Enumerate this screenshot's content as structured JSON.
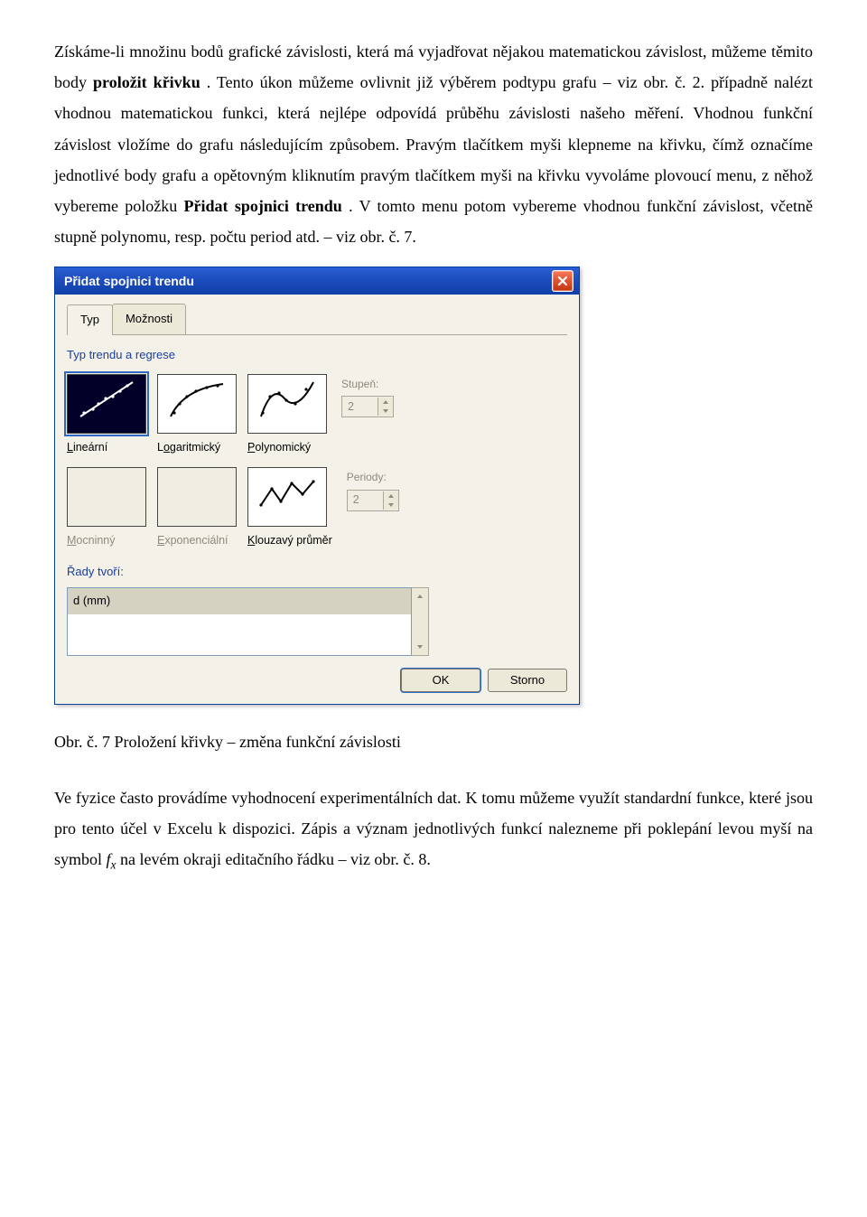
{
  "paragraph1": {
    "t1": "Získáme-li množinu bodů grafické závislosti, která má vyjadřovat nějakou matematickou závislost, můžeme těmito body ",
    "bold1": "proložit křivku",
    "t2": ". Tento úkon můžeme ovlivnit již výběrem podtypu grafu – viz obr. č. 2. případně nalézt vhodnou matematickou funkci, která nejlépe odpovídá průběhu závislosti našeho měření. Vhodnou funkční závislost vložíme do grafu následujícím způsobem. Pravým tlačítkem myši klepneme na křivku, čímž označíme jednotlivé body grafu a opětovným kliknutím pravým tlačítkem myši na křivku vyvoláme plovoucí menu, z něhož vybereme položku ",
    "bold2": "Přidat spojnici trendu",
    "t3": ". V tomto menu potom vybereme vhodnou funkční závislost, včetně stupně polynomu, resp. počtu period atd. – viz obr. č. 7."
  },
  "dialog": {
    "title": "Přidat spojnici trendu",
    "tabs": {
      "type": "Typ",
      "options": "Možnosti"
    },
    "group_label": "Typ trendu a regrese",
    "trend": {
      "linear": "Lineární",
      "log": "Logaritmický",
      "poly": "Polynomický",
      "power": "Mocninný",
      "expo": "Exponenciální",
      "movavg": "Klouzavý průměr"
    },
    "degree_label": "Stupeň:",
    "degree_value": "2",
    "periods_label": "Periody:",
    "periods_value": "2",
    "series_label": "Řady tvoří:",
    "series_item": "d (mm)",
    "ok": "OK",
    "cancel": "Storno"
  },
  "caption": "Obr. č. 7 Proložení křivky – změna funkční závislosti",
  "paragraph2": {
    "t1": "Ve fyzice často provádíme vyhodnocení experimentálních dat. K tomu můžeme využít standardní funkce, které jsou pro tento účel v Excelu k dispozici. Zápis a význam jednotlivých funkcí nalezneme při poklepání levou myší na symbol ",
    "fx": "f",
    "fx_sub": "x",
    "t2": " na levém okraji editačního řádku – viz obr. č. 8."
  }
}
